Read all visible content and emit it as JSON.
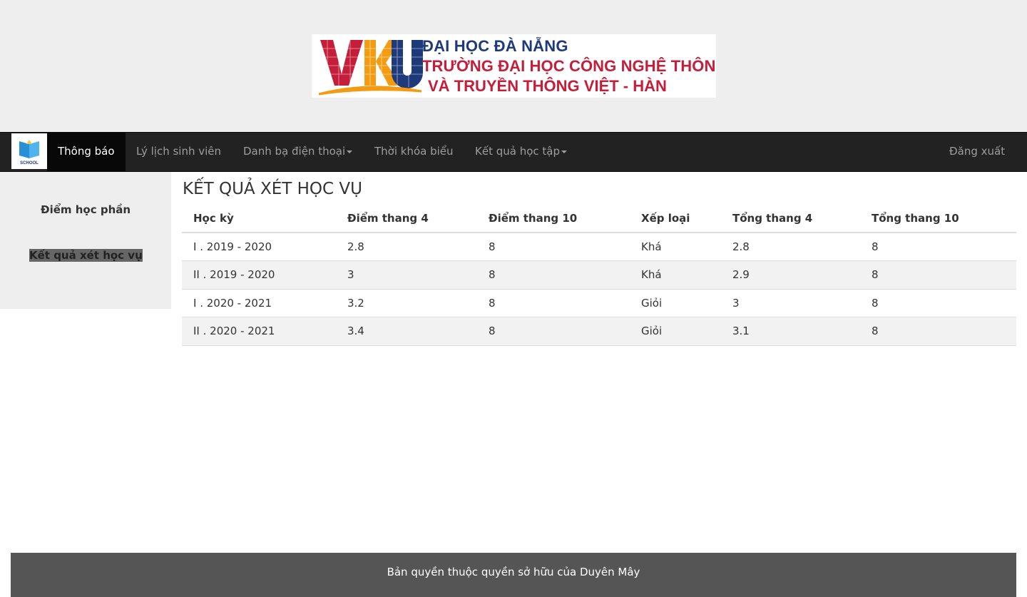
{
  "banner": {
    "logo_letters": "VKU",
    "line1": "ĐẠI HỌC ĐÀ NẴNG",
    "line2": "TRƯỜNG ĐẠI HỌC CÔNG NGHỆ THÔNG TIN",
    "line3": "VÀ TRUYỀN THÔNG VIỆT - HÀN",
    "colors": {
      "blue": "#1f3a7a",
      "red": "#c41e3a",
      "orange": "#f39c12"
    }
  },
  "navbar": {
    "logo_label": "SCHOOL",
    "items": [
      {
        "label": "Thông báo",
        "active": true
      },
      {
        "label": "Lý lịch sinh viên"
      },
      {
        "label": "Danh bạ điện thoại",
        "dropdown": true
      },
      {
        "label": "Thời khóa biểu"
      },
      {
        "label": "Kết quả học tập",
        "dropdown": true
      }
    ],
    "logout": "Đăng xuất"
  },
  "sidebar": {
    "items": [
      {
        "label": "Điểm học phần"
      },
      {
        "label": "Kết quả xét học vụ",
        "selected": true
      }
    ]
  },
  "main": {
    "title": "KẾT QUẢ XÉT HỌC VỤ",
    "table": {
      "headers": [
        "Học kỳ",
        "Điểm thang 4",
        "Điểm thang 10",
        "Xếp loại",
        "Tổng thang 4",
        "Tổng thang 10"
      ],
      "rows": [
        [
          "I . 2019 - 2020",
          "2.8",
          "8",
          "Khá",
          "2.8",
          "8"
        ],
        [
          "II . 2019 - 2020",
          "3",
          "8",
          "Khá",
          "2.9",
          "8"
        ],
        [
          "I . 2020 - 2021",
          "3.2",
          "8",
          "Giỏi",
          "3",
          "8"
        ],
        [
          "II . 2020 - 2021",
          "3.4",
          "8",
          "Giỏi",
          "3.1",
          "8"
        ]
      ]
    }
  },
  "footer": {
    "text": "Bản quyền thuộc quyền sở hữu của Duyên Mây"
  }
}
